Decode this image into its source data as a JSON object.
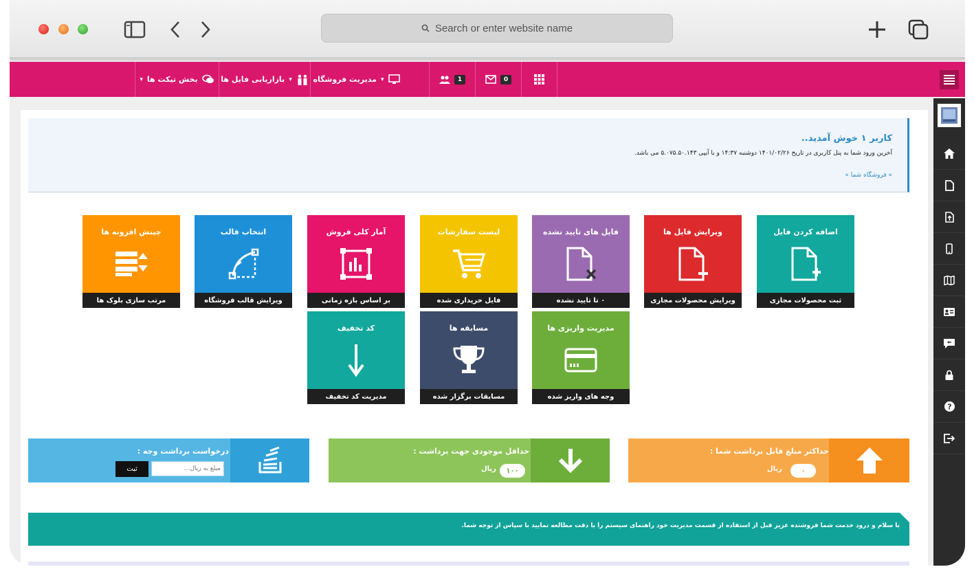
{
  "browser": {
    "url_placeholder": "Search or enter website name"
  },
  "topnav": {
    "tickets": "بخش تیکت ها",
    "file_rating": "بازاریابی فایل ها",
    "store_management": "مدیریت فروشگاه",
    "users_count": "1",
    "messages_count": "0"
  },
  "welcome": {
    "title": "کاربر ۱ خوش آمدید..",
    "last_login": "آخرین ورود شما به پنل کاربری در تاریخ ۱۴۰۱/۰۲/۲۶ دوشنبه ۱۴:۳۷ و با آیپی ۵.۰۷۵.۵۰.۱۴۳ می باشد.",
    "store_link": "« فروشگاه شما »"
  },
  "tiles": [
    {
      "title": "اضافه کردن فایل",
      "footer": "ثبت محصولات مجازی",
      "color": "#12a89d",
      "icon": "file-add-icon"
    },
    {
      "title": "ویرایش فایل ها",
      "footer": "ویرایش محصولات مجازی",
      "color": "#dd2a2c",
      "icon": "file-edit-icon"
    },
    {
      "title": "فایل های تایید نشده",
      "footer": "۰ تا تایید نشده",
      "color": "#9b6bb2",
      "icon": "file-rejected-icon"
    },
    {
      "title": "لیست سفارشات",
      "footer": "فایل خریداری شده",
      "color": "#f5c400",
      "icon": "cart-icon"
    },
    {
      "title": "آمار کلی فروش",
      "footer": "بر اساس بازه زمانی",
      "color": "#e6156a",
      "icon": "chart-icon"
    },
    {
      "title": "انتخاب قالب",
      "footer": "ویرایش قالب فروشگاه",
      "color": "#1e90d8",
      "icon": "template-icon"
    },
    {
      "title": "چینش افزونه ها",
      "footer": "مرتب سازی بلوک ها",
      "color": "#ff9500",
      "icon": "sort-blocks-icon"
    },
    {
      "title": "مدیریت واریزی ها",
      "footer": "وجه های واریز شده",
      "color": "#6dae3b",
      "icon": "card-icon"
    },
    {
      "title": "مسابقه ها",
      "footer": "مسابقات برگزار شده",
      "color": "#3e4c6b",
      "icon": "trophy-icon"
    },
    {
      "title": "کد تخفیف",
      "footer": "مدیریت کد تخفیف",
      "color": "#12a89d",
      "icon": "arrow-down-icon"
    }
  ],
  "stats": {
    "max_withdraw_title": "حداکثر مبلغ قابل برداشت شما :",
    "max_withdraw_value": "۰",
    "min_balance_title": "حداقل موجودی جهت برداشت :",
    "min_balance_value": "۱۰۰",
    "currency": "ریال",
    "request_title": "درخواست برداشت وجه :",
    "request_placeholder": "مبلغ به ریال...",
    "request_button": "ثبت"
  },
  "notice": {
    "text": "با سلام و درود خدمت شما فروشنده عزیز  قبل از استفاده از قسمت مدیریت خود راهنمای سیستم را با دقت مطالعه نمایید   با سپاس از توجه شما."
  },
  "colors": {
    "nav": "#d9176d",
    "sidebar": "#2b2b2b",
    "max_withdraw": "#f7a94a",
    "min_balance": "#8dc55a",
    "request": "#55b6e4"
  }
}
